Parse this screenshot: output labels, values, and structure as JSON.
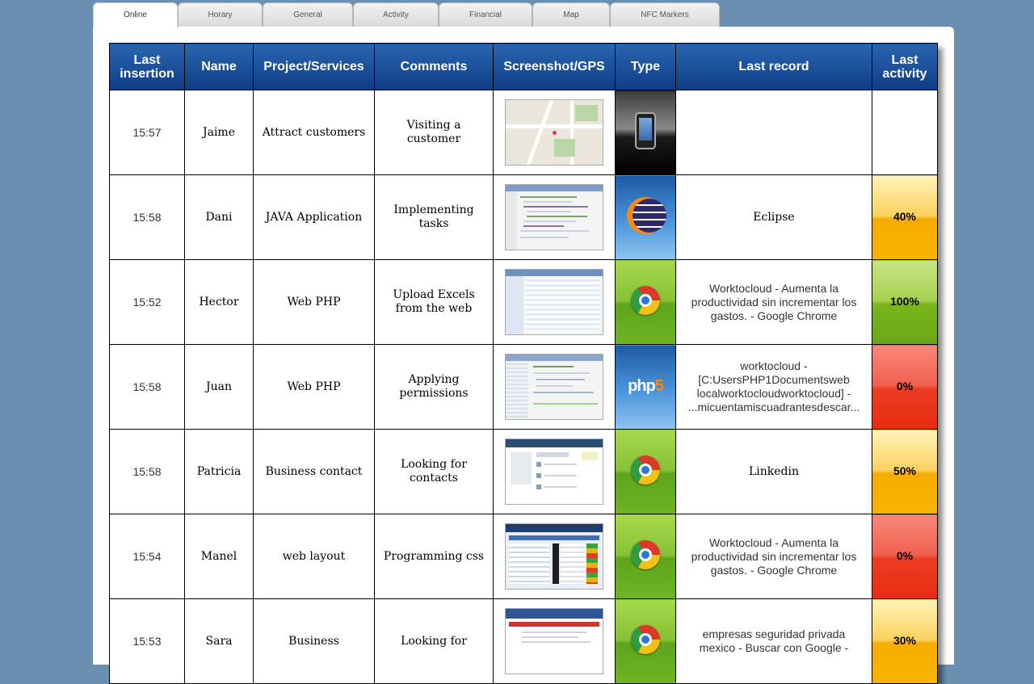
{
  "tabs": [
    "Online",
    "Horary",
    "General",
    "Activity",
    "Financial",
    "Map",
    "NFC Markers"
  ],
  "active_tab": "Online",
  "table": {
    "headers": [
      "Last insertion",
      "Name",
      "Project/Services",
      "Comments",
      "Screenshot/GPS",
      "Type",
      "Last record",
      "Last activity"
    ],
    "rows": [
      {
        "time": "15:57",
        "name": "Jaime",
        "project": "Attract customers",
        "comments": "Visiting a customer",
        "screenshot": "map-thumbnail",
        "type_icon": "phone-icon",
        "type_bg": "phone",
        "last_record": "",
        "last_activity": "",
        "activity_color": "none"
      },
      {
        "time": "15:58",
        "name": "Dani",
        "project": "JAVA Application",
        "comments": "Implementing tasks",
        "screenshot": "code-editor-thumbnail",
        "type_icon": "eclipse-icon",
        "type_bg": "blue",
        "last_record": "Eclipse",
        "last_activity": "40%",
        "activity_color": "yellow"
      },
      {
        "time": "15:52",
        "name": "Hector",
        "project": "Web PHP",
        "comments": "Upload Excels from the web",
        "screenshot": "spreadsheet-thumbnail",
        "type_icon": "chrome-icon",
        "type_bg": "chrome",
        "last_record": "Worktocloud - Aumenta la productividad sin incrementar los gastos. - Google Chrome",
        "last_activity": "100%",
        "activity_color": "green"
      },
      {
        "time": "15:58",
        "name": "Juan",
        "project": "Web PHP",
        "comments": "Applying permissions",
        "screenshot": "ide-thumbnail",
        "type_icon": "php-icon",
        "type_bg": "blue",
        "last_record": "worktocloud - [C:UsersPHP1Documentsweb localworktocloudworktocloud] - ...micuentamiscuadrantesdescar...",
        "last_activity": "0%",
        "activity_color": "red"
      },
      {
        "time": "15:58",
        "name": "Patricia",
        "project": "Business contact",
        "comments": "Looking for contacts",
        "screenshot": "linkedin-thumbnail",
        "type_icon": "chrome-icon",
        "type_bg": "chrome",
        "last_record": "Linkedin",
        "last_activity": "50%",
        "activity_color": "yellow"
      },
      {
        "time": "15:54",
        "name": "Manel",
        "project": "web layout",
        "comments": "Programming css",
        "screenshot": "webapp-thumbnail",
        "type_icon": "chrome-icon",
        "type_bg": "chrome",
        "last_record": "Worktocloud - Aumenta la productividad sin incrementar los gastos. - Google Chrome",
        "last_activity": "0%",
        "activity_color": "red"
      },
      {
        "time": "15:53",
        "name": "Sara",
        "project": "Business",
        "comments": "Looking for",
        "screenshot": "website-thumbnail",
        "type_icon": "chrome-icon",
        "type_bg": "chrome",
        "last_record": "empresas seguridad privada mexico - Buscar con Google -",
        "last_activity": "30%",
        "activity_color": "yellow"
      }
    ]
  },
  "php_label": {
    "main": "php",
    "accent": "5"
  }
}
